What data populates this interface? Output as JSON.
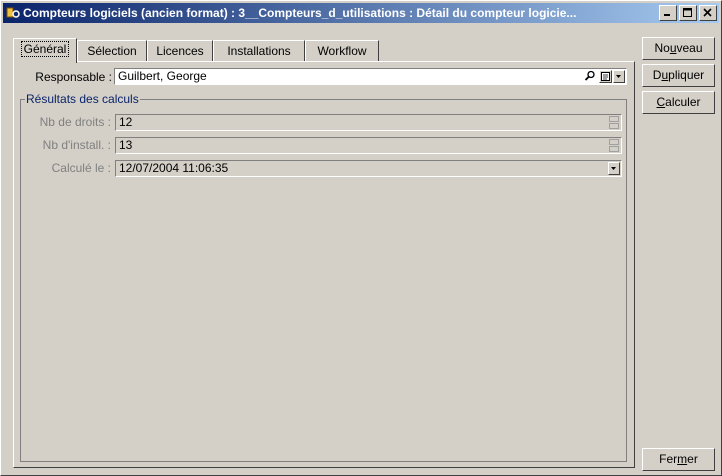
{
  "window": {
    "title": "Compteurs logiciels (ancien format) : 3__Compteurs_d_utilisations : Détail du compteur logicie..."
  },
  "tabs": [
    {
      "label": "Général",
      "active": true
    },
    {
      "label": "Sélection",
      "active": false
    },
    {
      "label": "Licences",
      "active": false
    },
    {
      "label": "Installations",
      "active": false
    },
    {
      "label": "Workflow",
      "active": false
    }
  ],
  "form": {
    "responsable_label": "Responsable :",
    "responsable_value": "Guilbert, George",
    "group_title": "Résultats des calculs",
    "nb_droits_label": "Nb de droits :",
    "nb_droits_value": "12",
    "nb_install_label": "Nb d'install. :",
    "nb_install_value": "13",
    "calcule_label": "Calculé le :",
    "calcule_value": "12/07/2004 11:06:35"
  },
  "buttons": {
    "nouveau": {
      "pre": "No",
      "acc": "u",
      "post": "veau"
    },
    "dupliquer": {
      "pre": "D",
      "acc": "u",
      "post": "pliquer"
    },
    "calculer": {
      "pre": "",
      "acc": "C",
      "post": "alculer"
    },
    "fermer": {
      "pre": "Fer",
      "acc": "m",
      "post": "er"
    }
  },
  "colors": {
    "titlebar_start": "#0a246a",
    "titlebar_end": "#a6caf0",
    "face": "#d4d0c8",
    "group_title": "#0a246a"
  },
  "icons": [
    "app-icon",
    "minimize-icon",
    "maximize-icon",
    "close-icon",
    "zoom-icon",
    "details-icon",
    "dropdown-arrow-icon",
    "spin-up-icon",
    "spin-down-icon"
  ]
}
